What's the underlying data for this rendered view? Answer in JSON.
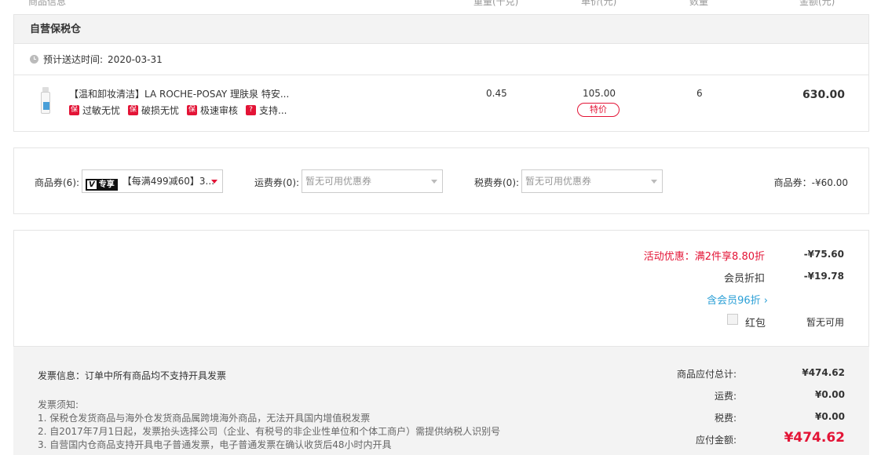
{
  "columns": {
    "product_info": "商品信息",
    "weight": "重量(千克)",
    "unit_price": "单价(元)",
    "quantity": "数量",
    "amount": "金额(元)"
  },
  "warehouse": {
    "name": "自营保税仓",
    "delivery_label": "预计送达时间:",
    "delivery_date": "2020-03-31"
  },
  "product": {
    "title": "【温和卸妆清洁】LA ROCHE-POSAY 理肤泉 特安...",
    "tags": [
      {
        "icon_text": "保",
        "label": "过敏无忧"
      },
      {
        "icon_text": "保",
        "label": "破损无忧"
      },
      {
        "icon_text": "保",
        "label": "极速审核"
      },
      {
        "icon_text": "?",
        "label": "支持..."
      }
    ],
    "weight": "0.45",
    "unit_price": "105.00",
    "special_badge": "特价",
    "quantity": "6",
    "amount": "630.00"
  },
  "coupons": {
    "product_coupon_label": "商品券(6):",
    "product_coupon_badge_v": "V",
    "product_coupon_badge_text": "专享",
    "product_coupon_value": "【每满499减60】3...",
    "shipping_coupon_label": "运费券(0):",
    "shipping_coupon_placeholder": "暂无可用优惠券",
    "tax_coupon_label": "税费券(0):",
    "tax_coupon_placeholder": "暂无可用优惠券",
    "summary": "商品券：-¥60.00"
  },
  "discounts": {
    "promo_label": "活动优惠：满2件享8.80折",
    "promo_value": "-¥75.60",
    "member_label": "会员折扣",
    "member_value": "-¥19.78",
    "member_link": "含会员96折 ›",
    "redpacket_label": "红包",
    "redpacket_value": "暂无可用"
  },
  "invoice": {
    "info": "发票信息：订单中所有商品均不支持开具发票",
    "notes_title": "发票须知:",
    "notes": [
      "1. 保税仓发货商品与海外仓发货商品属跨境海外商品，无法开具国内增值税发票",
      "2. 自2017年7月1日起，发票抬头选择公司（企业、有税号的非企业性单位和个体工商户）需提供纳税人识别号",
      "3. 自营国内仓商品支持开具电子普通发票，电子普通发票在确认收货后48小时内开具"
    ]
  },
  "totals": {
    "goods_label": "商品应付总计:",
    "goods_value": "¥474.62",
    "shipping_label": "运费:",
    "shipping_value": "¥0.00",
    "tax_label": "税费:",
    "tax_value": "¥0.00",
    "payable_label": "应付金额:",
    "payable_value": "¥474.62"
  },
  "colors": {
    "accent_red": "#e31436",
    "link_blue": "#2a9fd6"
  }
}
